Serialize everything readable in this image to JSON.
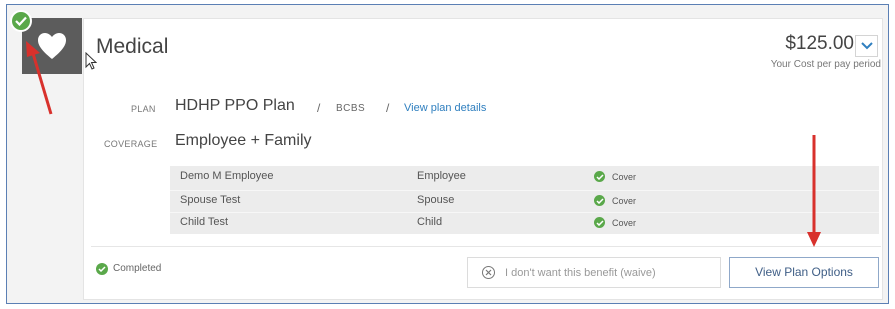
{
  "benefit": {
    "title": "Medical",
    "cost": "$125.00",
    "cost_label": "Your Cost per pay period",
    "plan_label": "PLAN",
    "plan_name": "HDHP PPO Plan",
    "separator": "/",
    "carrier": "BCBS",
    "view_details_link": "View plan details",
    "coverage_label": "COVERAGE",
    "coverage_value": "Employee + Family"
  },
  "dependents": [
    {
      "name": "Demo M Employee",
      "relationship": "Employee",
      "status": "Cover"
    },
    {
      "name": "Spouse Test",
      "relationship": "Spouse",
      "status": "Cover"
    },
    {
      "name": "Child Test",
      "relationship": "Child",
      "status": "Cover"
    }
  ],
  "footer": {
    "status": "Completed",
    "waive_button": "I don't want this benefit (waive)",
    "view_options_button": "View Plan Options"
  },
  "colors": {
    "accent_blue": "#2f7fbf",
    "success_green": "#5aa84a",
    "annotation_red": "#d8312c",
    "tile_gray": "#5c5c5c"
  },
  "icons": {
    "benefit_icon": "heart-icon",
    "completed_icon": "check-circle-icon",
    "waive_icon": "x-circle-icon",
    "dropdown_icon": "chevron-down-icon"
  }
}
